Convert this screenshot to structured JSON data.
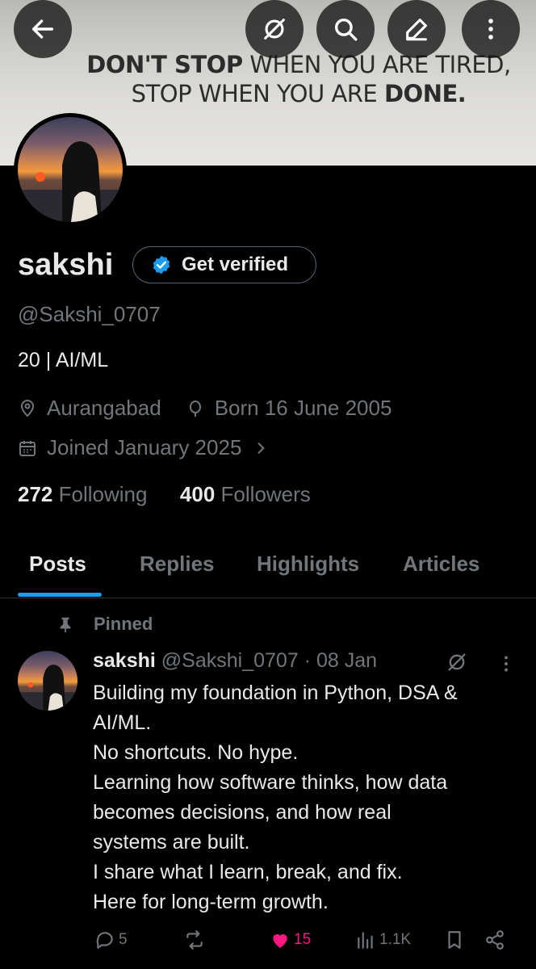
{
  "banner": {
    "quote_line1_bold": "DON'T STOP",
    "quote_line1_rest": " WHEN YOU ARE TIRED,",
    "quote_line2_rest": "STOP WHEN YOU ARE ",
    "quote_line2_bold": "DONE."
  },
  "topbar": {
    "back_icon": "arrow-left-icon",
    "grok_icon": "grok-icon",
    "search_icon": "search-icon",
    "edit_icon": "edit-icon",
    "more_icon": "more-vertical-icon"
  },
  "profile": {
    "name": "sakshi",
    "get_verified_label": "Get verified",
    "handle": "@Sakshi_0707",
    "bio": "20 | AI/ML",
    "location": "Aurangabad",
    "birthday": "Born 16 June 2005",
    "joined": "Joined January 2025",
    "following_count": "272",
    "following_label": "Following",
    "followers_count": "400",
    "followers_label": "Followers"
  },
  "tabs": [
    "Posts",
    "Replies",
    "Highlights",
    "Articles"
  ],
  "active_tab": "Posts",
  "post": {
    "pinned_label": "Pinned",
    "author_name": "sakshi",
    "author_meta": "@Sakshi_0707 · 08 Jan",
    "lines": [
      "Building my foundation in Python, DSA &",
      "AI/ML.",
      "No shortcuts. No hype.",
      "Learning how software thinks, how data",
      "becomes decisions, and how real",
      "systems are built.",
      "I share what I learn, break, and fix.",
      "Here for long-term growth."
    ],
    "replies": "5",
    "likes": "15",
    "views": "1.1K"
  },
  "colors": {
    "accent": "#1d9bf0",
    "like": "#f91880",
    "muted": "#71767b",
    "text": "#e7e9ea",
    "background": "#000000"
  }
}
